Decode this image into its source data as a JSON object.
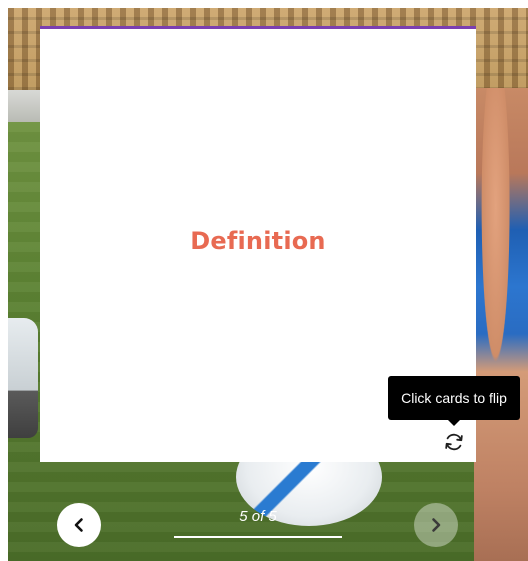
{
  "card": {
    "term": "Definition",
    "accent_color": "#7b3fb1",
    "term_color": "#e86a52"
  },
  "tooltip": {
    "text": "Click cards to flip"
  },
  "flip_button": {
    "icon": "refresh-icon"
  },
  "navigation": {
    "prev_icon": "chevron-left-icon",
    "next_icon": "chevron-right-icon",
    "counter_text": "5 of 5",
    "progress": 1.0
  }
}
